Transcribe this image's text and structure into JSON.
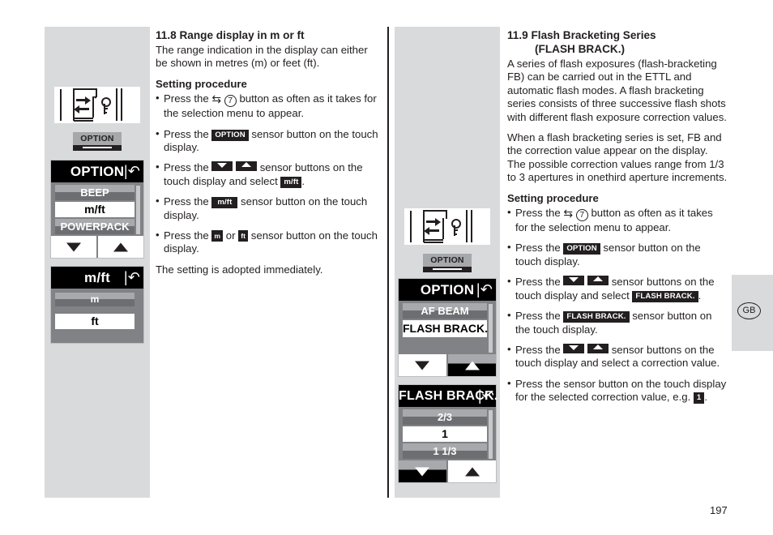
{
  "page": {
    "number": "197",
    "locale_badge": "GB"
  },
  "left_panel": {
    "device_caption": "OPTION",
    "menu_option": {
      "title": "OPTION",
      "back_icon": "back-arrow-icon",
      "items": [
        {
          "label": "BEEP",
          "state": "dim"
        },
        {
          "label": "m/ft",
          "state": "selected"
        },
        {
          "label": "POWERPACK",
          "state": "dim"
        }
      ],
      "nav": {
        "down": "down-arrow-icon",
        "up": "up-arrow-icon"
      }
    },
    "menu_mft": {
      "title": "m/ft",
      "back_icon": "back-arrow-icon",
      "items": [
        {
          "label": "m",
          "state": "dim"
        },
        {
          "label": "ft",
          "state": "selected"
        }
      ]
    }
  },
  "middle_panel": {
    "device_caption": "OPTION",
    "menu_option": {
      "title": "OPTION",
      "back_icon": "back-arrow-icon",
      "items": [
        {
          "label": "AF BEAM",
          "state": "dim"
        },
        {
          "label": "FLASH BRACK.",
          "state": "selected"
        }
      ],
      "nav": {
        "down": "down-arrow-icon",
        "up": "up-arrow-icon"
      }
    },
    "menu_flash_brack": {
      "title": "FLASH BRACK.",
      "back_icon": "back-arrow-icon",
      "items": [
        {
          "label": "2/3",
          "state": "dim"
        },
        {
          "label": "1",
          "state": "selected"
        },
        {
          "label": "1 1/3",
          "state": "dim"
        }
      ],
      "nav": {
        "down": "down-arrow-icon",
        "up": "up-arrow-icon"
      }
    }
  },
  "section_118": {
    "heading": "11.8 Range display in m or ft",
    "intro": "The range indication in the display can either be shown in metres (m) or feet (ft).",
    "procedure_heading": "Setting procedure",
    "steps": [
      {
        "pre": "Press the ",
        "sym": "swap-seven",
        "post": " button as often as it takes for the selection menu to appear."
      },
      {
        "pre": "Press the ",
        "badge": "OPTION",
        "post": " sensor button on the touch display."
      },
      {
        "pre": "Press the ",
        "arrows": "down-up",
        "mid": " sensor buttons on the touch display and select ",
        "badge2": "m/ft",
        "post": "."
      },
      {
        "pre": "Press the ",
        "badge": "m/ft",
        "post": " sensor button on the touch display."
      },
      {
        "pre": "Press the ",
        "badge": "m",
        "mid": " or ",
        "badge2": "ft",
        "post": " sensor button on the touch display."
      }
    ],
    "closing": "The setting is adopted immediately."
  },
  "section_119": {
    "heading_line1": "11.9 Flash Bracketing Series",
    "heading_line2": "(FLASH BRACK.)",
    "para1": "A series of flash exposures (flash-bracketing FB) can be carried out in the ETTL and automatic flash modes. A flash bracketing series consists of three successive flash shots with different flash exposure correction values.",
    "para2": "When a flash bracketing series is set, FB and the correction value appear on the display. The possible correction values range from 1/3 to 3 apertures in onethird aperture increments.",
    "procedure_heading": "Setting procedure",
    "steps": [
      {
        "pre": "Press the ",
        "sym": "swap-seven",
        "post": " button as often as it takes for the selection menu to appear."
      },
      {
        "pre": "Press the ",
        "badge": "OPTION",
        "post": " sensor button on the touch display."
      },
      {
        "pre": "Press the ",
        "arrows": "down-up",
        "mid": " sensor buttons on the touch display and select ",
        "badge2": "FLASH BRACK.",
        "post": "."
      },
      {
        "pre": "Press the ",
        "badge": "FLASH BRACK.",
        "post": " sensor button on the touch display."
      },
      {
        "pre": "Press the ",
        "arrows": "down-up",
        "mid": " sensor buttons on the touch display and select a correction value."
      },
      {
        "pre": "Press the sensor button on the touch display for the selected correction value, e.g. ",
        "badge2": "1",
        "post": "."
      }
    ]
  },
  "symbols": {
    "swap": "⇆",
    "seven": "7",
    "back_arrow": "↶"
  }
}
